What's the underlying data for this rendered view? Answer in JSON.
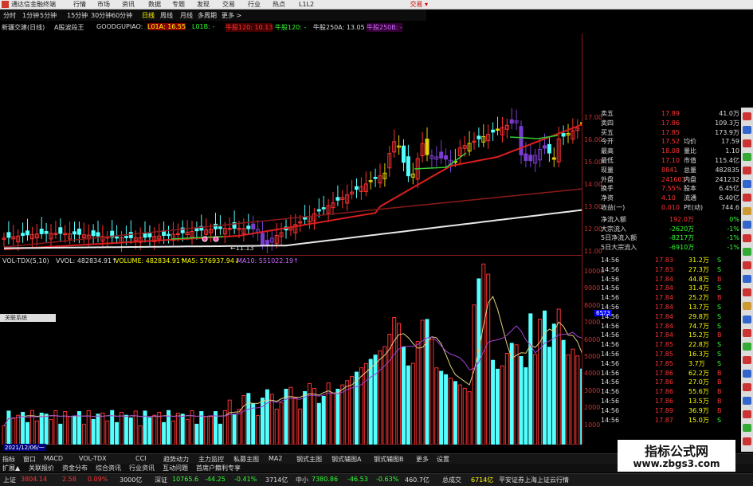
{
  "app": {
    "title": "通达信金融终端",
    "login": "交易 ▾"
  },
  "menu": [
    "行情",
    "市场",
    "资讯",
    "数据",
    "专题",
    "发现",
    "交易",
    "行业",
    "热点",
    "L1L2"
  ],
  "periods": [
    "分时",
    "1分钟",
    "5分钟",
    "15分钟",
    "30分钟",
    "60分钟",
    "日线",
    "周线",
    "月线",
    "多周期",
    "更多 >"
  ],
  "active_period": "日线",
  "stockbar": {
    "name": "新疆交建(日线)",
    "tag": "A股波段王",
    "formula": "GOODGUPIAO:",
    "l01a": "L01A: 16.55",
    "l01b": "L01B: -",
    "ma120": "牛股120: 10.13",
    "ma120b": "牛股120: -",
    "ma250": "牛股250A: 13.05",
    "ma250b": "牛股250B: -"
  },
  "price_axis": [
    "17.00",
    "16.00",
    "15.00",
    "14.00",
    "13.00",
    "12.00",
    "11.00"
  ],
  "price_low_label": "←11.13",
  "vol_axis": [
    "10000",
    "9000",
    "8000",
    "7000",
    "6000",
    "5000",
    "4000",
    "3000",
    "2000",
    "1000"
  ],
  "vol_head": {
    "name": "VOL-TDX(5,10)",
    "vvol": "VVOL: 482834.91↑",
    "volume": "VOLUME: 482834.91↑",
    "ma5": "MA5: 576937.94↓",
    "ma10": "MA10: 551022.19↑"
  },
  "vol_marker": "6573",
  "mini_box": "关联系统",
  "date_label": "2021/12/06/一",
  "indicators": [
    "指标",
    "窗口",
    "MACD",
    "VOL-TDX",
    "CCI",
    "趋势动力",
    "主力监控",
    "私募主图",
    "MA2",
    "钢式主图",
    "钢式辅图A",
    "钢式辅图B",
    "更多",
    "设置"
  ],
  "tabs2": [
    "扩展▲",
    "关联报价",
    "资金分布",
    "综合资讯",
    "行业资讯",
    "互动问题",
    "首席户籍利专享"
  ],
  "quote_panel": [
    {
      "l": "卖五",
      "v": "17.89",
      "r": "41.0万"
    },
    {
      "l": "卖四",
      "v": "17.86",
      "r": "109.3万"
    },
    {
      "l": "买五",
      "v": "17.85",
      "r": "173.9万"
    },
    {
      "l": "今开",
      "v": "17.52",
      "m": "均价",
      "r": "17.59"
    },
    {
      "l": "最高",
      "v": "18.08",
      "m": "量比",
      "r": "1.10"
    },
    {
      "l": "最低",
      "v": "17.10",
      "m": "市值",
      "r": "115.4亿"
    },
    {
      "l": "现量",
      "v": "8841",
      "m": "总量",
      "r": "482835"
    },
    {
      "l": "外盘",
      "v": "241603",
      "m": "内盘",
      "r": "241232"
    },
    {
      "l": "换手",
      "v": "7.55%",
      "m": "股本",
      "r": "6.45亿"
    },
    {
      "l": "净资",
      "v": "4.10",
      "m": "流通",
      "r": "6.40亿"
    },
    {
      "l": "收益(一)",
      "v": "0.010",
      "m": "PE(动)",
      "r": "744.6"
    }
  ],
  "flow_panel": [
    {
      "l": "净流入额",
      "v": "192.0万",
      "r": "0%"
    },
    {
      "l": "大宗流入",
      "v": "-2620万",
      "r": "-1%"
    },
    {
      "l": "5日净流入额",
      "v": "-8217万",
      "r": "-1%"
    },
    {
      "l": "5日大宗流入",
      "v": "-6910万",
      "r": "-1%"
    }
  ],
  "ticks": [
    [
      "14:56",
      "17.83",
      "31.2万",
      "S"
    ],
    [
      "14:56",
      "17.83",
      "27.3万",
      "S"
    ],
    [
      "14:56",
      "17.84",
      "44.8万",
      "B"
    ],
    [
      "14:56",
      "17.84",
      "31.4万",
      "S"
    ],
    [
      "14:56",
      "17.84",
      "25.2万",
      "B"
    ],
    [
      "14:56",
      "17.84",
      "13.7万",
      "S"
    ],
    [
      "14:56",
      "17.84",
      "29.8万",
      "S"
    ],
    [
      "14:56",
      "17.84",
      "74.7万",
      "S"
    ],
    [
      "14:56",
      "17.84",
      "15.2万",
      "B"
    ],
    [
      "14:56",
      "17.85",
      "22.8万",
      "S"
    ],
    [
      "14:56",
      "17.85",
      "16.3万",
      "S"
    ],
    [
      "14:56",
      "17.85",
      "3.7万",
      "S"
    ],
    [
      "14:56",
      "17.86",
      "62.2万",
      "B"
    ],
    [
      "14:56",
      "17.86",
      "27.0万",
      "B"
    ],
    [
      "14:56",
      "17.86",
      "55.6万",
      "B"
    ],
    [
      "14:56",
      "17.86",
      "13.5万",
      "B"
    ],
    [
      "14:56",
      "17.89",
      "36.9万",
      "B"
    ],
    [
      "14:56",
      "17.87",
      "15.0万",
      "S"
    ]
  ],
  "status": {
    "sh_label": "上证",
    "sh_val": "3804.14",
    "sh_chg": "2.58",
    "sh_pct": "0.09%",
    "sh_amt": "3000亿",
    "sz_label": "深证",
    "sz_val": "10765.6",
    "sz_chg": "-44.25",
    "sz_pct": "-0.41%",
    "sz_amt": "3714亿",
    "zx_label": "中小",
    "zx_val": "7380.86",
    "zx_chg": "-46.53",
    "zx_pct": "-0.63%",
    "zx_amt": "460.7亿",
    "total_label": "总成交",
    "total_amt": "6714亿",
    "server": "平安证券上海上证云行情"
  },
  "watermark": {
    "title": "指标公式网",
    "url": "www.zbgs3.com"
  },
  "colors": {
    "up": "#ff3232",
    "down": "#54ffff",
    "yellow": "#e0d000",
    "purple": "#7a3ccf",
    "green": "#3c3",
    "ma_red": "#dd1e1e",
    "ma_dark": "#8b1a1a",
    "ma_white": "#e8e8e8"
  }
}
